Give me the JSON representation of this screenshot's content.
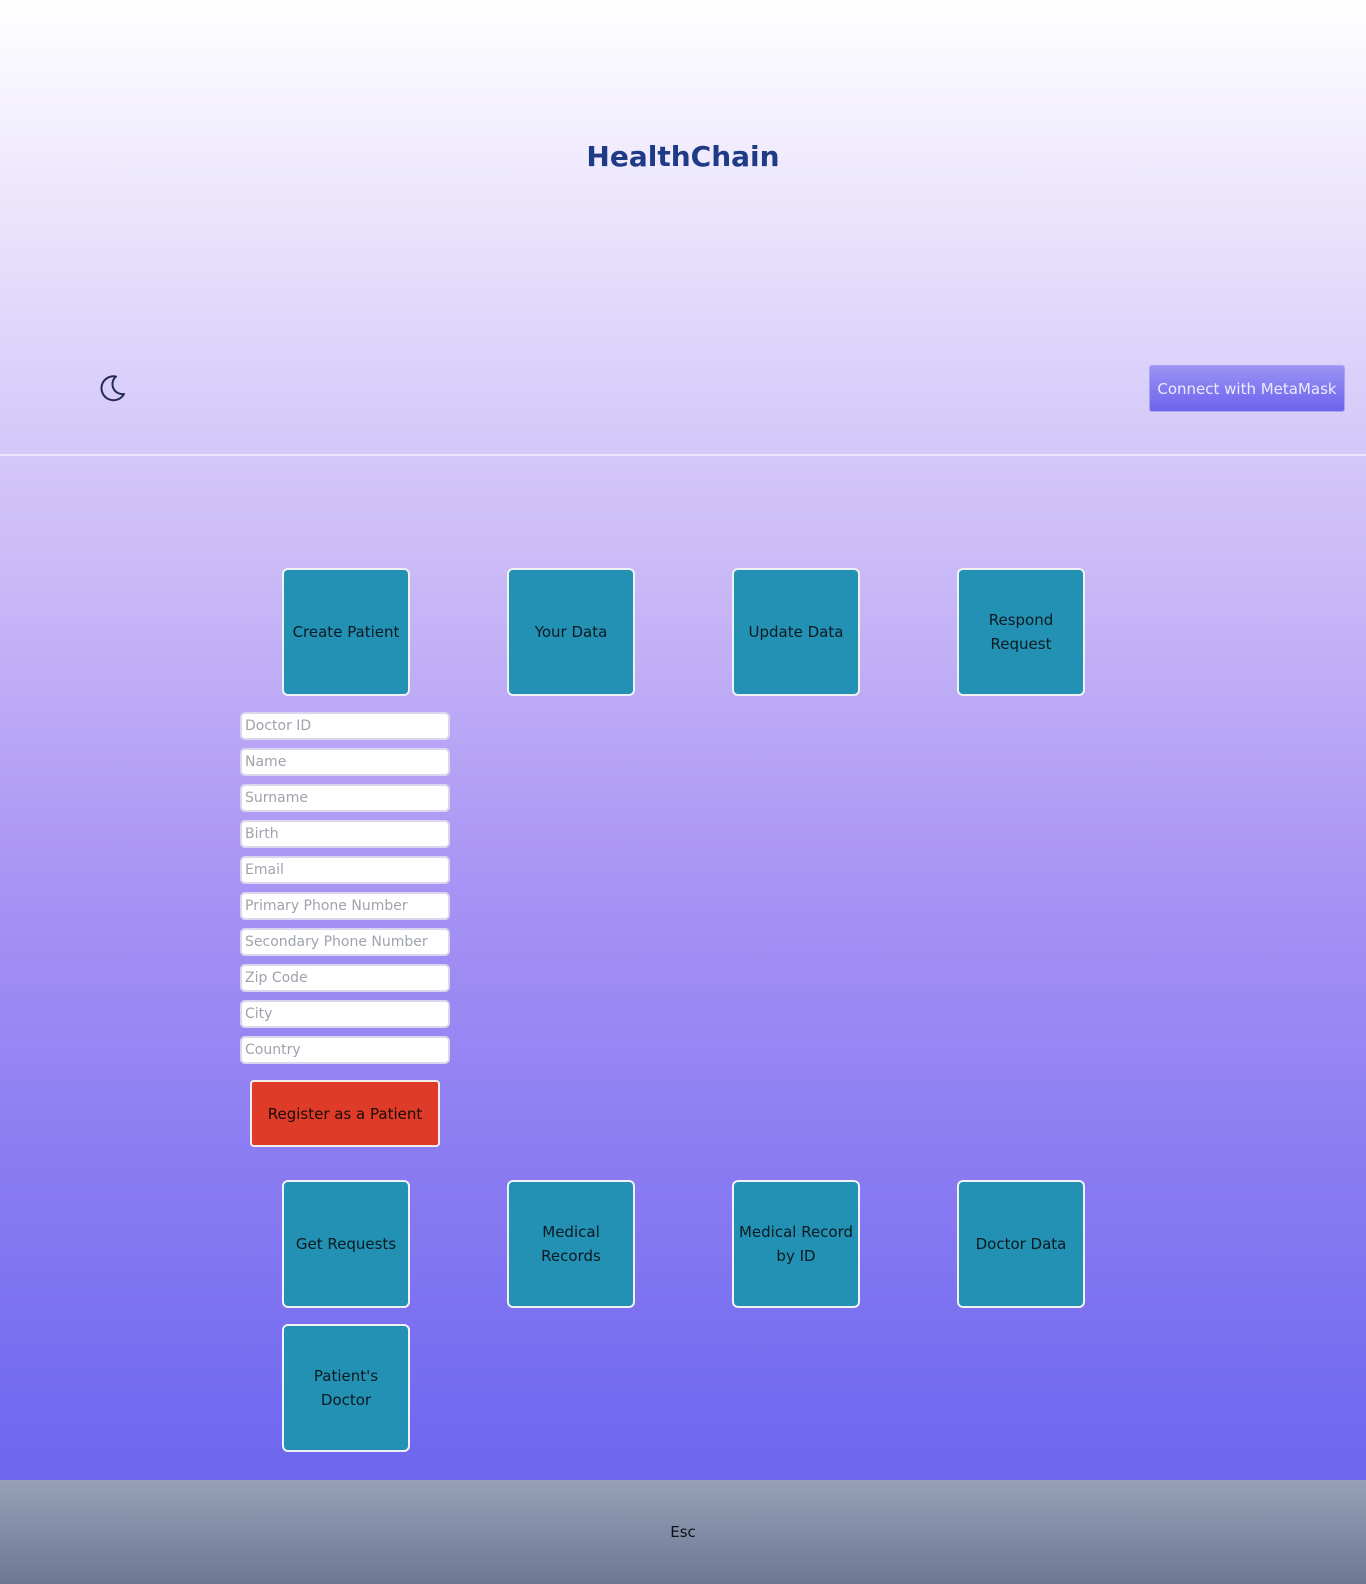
{
  "header": {
    "title": "HealthChain",
    "theme_toggle_icon": "moon-icon",
    "connect_label": "Connect with MetaMask"
  },
  "tiles_row1": [
    {
      "label": "Create Patient"
    },
    {
      "label": "Your Data"
    },
    {
      "label": "Update Data"
    },
    {
      "label": "Respond Request"
    }
  ],
  "form": {
    "placeholders": {
      "doctor_id": "Doctor ID",
      "name": "Name",
      "surname": "Surname",
      "birth": "Birth",
      "email": "Email",
      "primary_phone": "Primary Phone Number",
      "secondary_phone": "Secondary Phone Number",
      "zip_code": "Zip Code",
      "city": "City",
      "country": "Country"
    },
    "submit_label": "Register as a Patient"
  },
  "tiles_row2": [
    {
      "label": "Get Requests"
    },
    {
      "label": "Medical Records"
    },
    {
      "label": "Medical Record by ID"
    },
    {
      "label": "Doctor Data"
    }
  ],
  "tiles_row3": [
    {
      "label": "Patient's Doctor"
    }
  ],
  "footer": {
    "esc_label": "Esc"
  },
  "colors": {
    "title": "#1f3a86",
    "tile": "#2291b3",
    "register_button": "#de3b28",
    "connect_button": "#6d63ee"
  }
}
